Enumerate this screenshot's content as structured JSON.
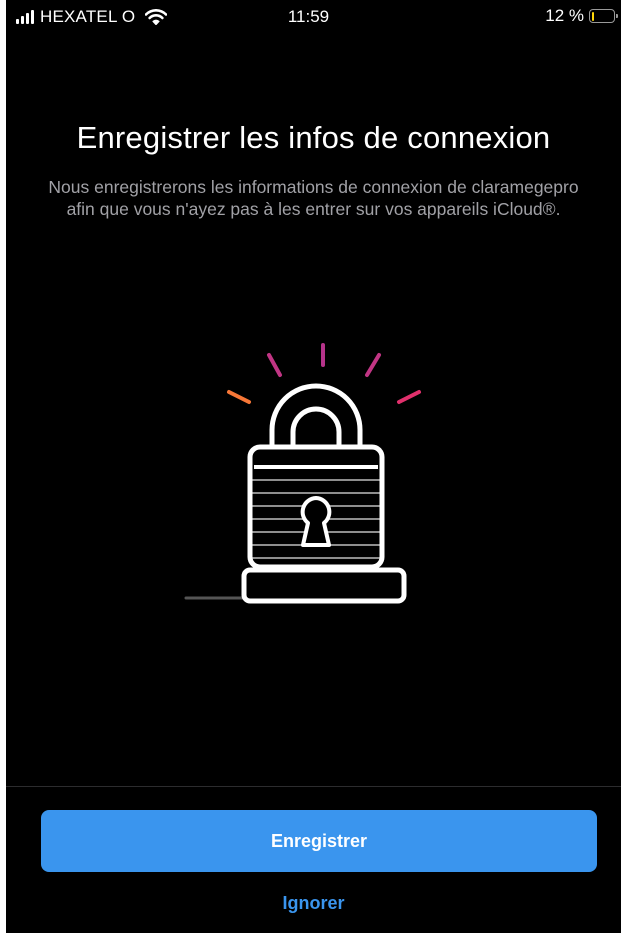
{
  "status_bar": {
    "carrier": "HEXATEL O",
    "time": "11:59",
    "battery_percent_label": "12 %",
    "battery_level": 0.12,
    "battery_color": "#ffd60a",
    "signal_icon": "signal-bars-icon",
    "wifi_icon": "wifi-icon",
    "battery_icon": "battery-icon"
  },
  "main": {
    "title": "Enregistrer les infos de connexion",
    "description": "Nous enregistrerons les informations de connexion de claramegepro afin que vous n'ayez pas à les entrer sur vos appareils iCloud®.",
    "illustration_icon": "padlock-icon"
  },
  "actions": {
    "save_label": "Enregistrer",
    "ignore_label": "Ignorer"
  },
  "colors": {
    "accent": "#3a95ee",
    "background": "#000000",
    "secondary_text": "#a1a1a6"
  }
}
